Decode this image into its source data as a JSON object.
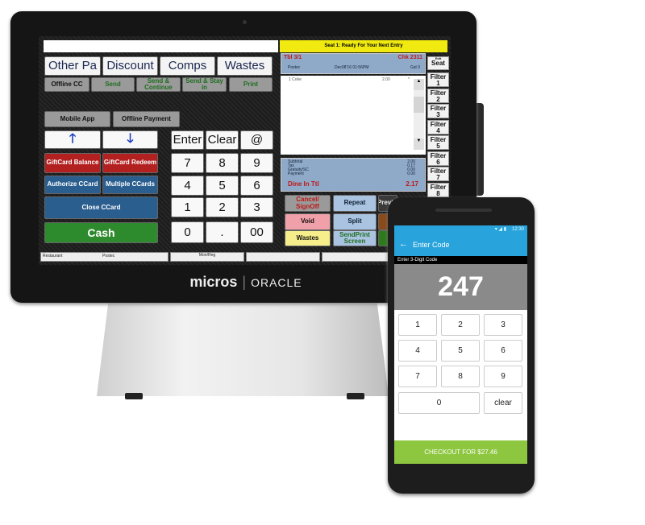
{
  "brand": {
    "name": "micros",
    "partner": "ORACLE"
  },
  "pos": {
    "top_bar": "",
    "prompt": "Seat 1: Ready For Your Next Entry",
    "row1": [
      "Other Pa",
      "Discount",
      "Comps",
      "Wastes"
    ],
    "row2": [
      "Offline CC",
      "Send",
      "Send & Continue",
      "Send & Stay in",
      "Print"
    ],
    "mobile_app": "Mobile App",
    "offline_payment": "Offline Payment",
    "up": "🡑",
    "down": "🡓",
    "giftcard_balance": "GiftCard Balance",
    "giftcard_redeem": "GiftCard Redeem",
    "authorize_ccard": "Authorize CCard",
    "multiple_ccards": "Multiple CCards",
    "close_ccard": "Close CCard",
    "cash": "Cash",
    "keypad_top": [
      "Enter",
      "Clear",
      "@"
    ],
    "keypad": [
      "7",
      "8",
      "9",
      "4",
      "5",
      "6",
      "1",
      "2",
      "3",
      "0",
      ".",
      "00"
    ],
    "check": {
      "table": "Tbl 3/1",
      "check": "Chk 2311",
      "employee": "Postec",
      "datetime": "Dec08'16 01:56PM",
      "guests": "Gst 0",
      "items": [
        {
          "qty": "1",
          "name": "Coke",
          "price": "2.00",
          "mark": "*"
        }
      ],
      "totals": [
        {
          "label": "Subtotal",
          "value": "2.00"
        },
        {
          "label": "Tax",
          "value": "0.17"
        },
        {
          "label": "Gratuity/SC",
          "value": "0.00"
        },
        {
          "label": "Payment",
          "value": "0.00"
        }
      ],
      "total_label": "Dine In Ttl",
      "total_value": "2.17"
    },
    "seat_small": "Edit",
    "seat": "Seat",
    "filters": [
      "Filter 1",
      "Filter 2",
      "Filter 3",
      "Filter 4",
      "Filter 5",
      "Filter 6",
      "Filter 7",
      "Filter 8",
      "Filter"
    ],
    "actions": [
      "Cancel/ SignOff",
      "Repeat",
      "Previ...",
      "Void",
      "Split",
      "",
      "Wastes",
      "SendPrint Screen",
      ""
    ],
    "status": {
      "left": "Restaurant",
      "left2": "Postec",
      "middle": "Mon/Reg"
    }
  },
  "phone": {
    "time": "12:30",
    "title": "Enter Code",
    "subtitle": "Enter 3-Digit Code",
    "code": "247",
    "keys": [
      "1",
      "2",
      "3",
      "4",
      "5",
      "6",
      "7",
      "8",
      "9",
      "0",
      "clear"
    ],
    "checkout": "CHECKOUT FOR $27.46",
    "colors": {
      "header": "#29a3dc",
      "checkout": "#8dc63f"
    }
  }
}
